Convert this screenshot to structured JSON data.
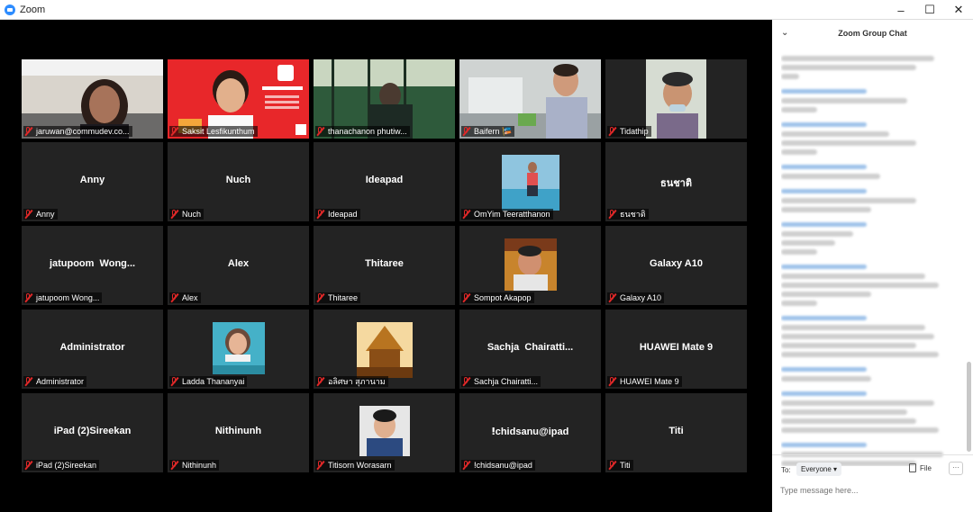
{
  "window": {
    "title": "Zoom",
    "controls": {
      "minimize": "–",
      "maximize": "☐",
      "close": "✕"
    }
  },
  "participants": [
    {
      "name": "jaruwan@commudev.co...",
      "video": true,
      "kind": "cam-woman"
    },
    {
      "name": "Saksit Lesfikunthum",
      "video": true,
      "kind": "cam-red",
      "active": true
    },
    {
      "name": "thanachanon phutiw...",
      "video": true,
      "kind": "cam-green"
    },
    {
      "name": "Baifern 🎏",
      "video": true,
      "kind": "cam-room"
    },
    {
      "name": "Tidathip",
      "video": true,
      "kind": "cam-lady"
    },
    {
      "name": "Anny",
      "video": false
    },
    {
      "name": "Nuch",
      "video": false
    },
    {
      "name": "Ideapad",
      "video": false
    },
    {
      "name": "OmYim Teeratthanon",
      "video": false,
      "avatar": "pool"
    },
    {
      "name": "ธนชาติ",
      "video": false
    },
    {
      "name": "jatupoom  Wong...",
      "video": false
    },
    {
      "name": "Alex",
      "video": false
    },
    {
      "name": "Thitaree",
      "video": false
    },
    {
      "name": "Sompot Akapop",
      "video": false,
      "avatar": "man"
    },
    {
      "name": "Galaxy A10",
      "video": false
    },
    {
      "name": "Administrator",
      "video": false
    },
    {
      "name": "Ladda Thananyai",
      "video": false,
      "avatar": "woman-card"
    },
    {
      "name": "อลิศษา สุภานาม",
      "video": false,
      "avatar": "temple"
    },
    {
      "name": "Sachja  Chairatti...",
      "video": false
    },
    {
      "name": "HUAWEI Mate 9",
      "video": false
    },
    {
      "name": "iPad (2)Sireekan",
      "video": false
    },
    {
      "name": "Nithinunh",
      "video": false
    },
    {
      "name": "Titisorn Worasarn",
      "video": false,
      "avatar": "young-man"
    },
    {
      "name": "ⵑchidsanu@ipad",
      "video": false
    },
    {
      "name": "Titi",
      "video": false
    }
  ],
  "chat": {
    "title": "Zoom Group Chat",
    "to_label": "To:",
    "to_value": "Everyone ▾",
    "file_label": "File",
    "more_label": "···",
    "input_placeholder": "Type message here..."
  },
  "colors": {
    "accent": "#2d8cff",
    "active_speaker": "#e8e84a",
    "muted": "#e02828",
    "tile": "#232323"
  }
}
